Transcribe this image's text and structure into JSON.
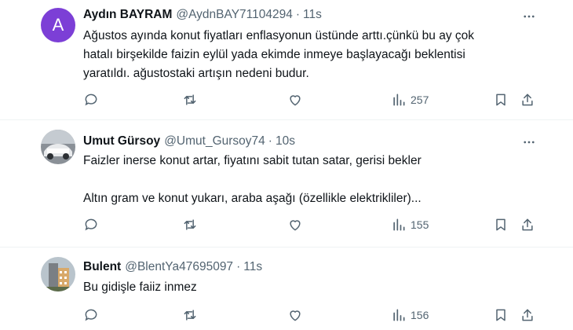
{
  "tweets": [
    {
      "avatar_letter": "A",
      "name": "Aydın BAYRAM",
      "handle": "@AydnBAY71104294",
      "separator": "·",
      "time": "11s",
      "lines": [
        "Ağustos ayında konut fiyatları enflasyonun üstünde arttı.çünkü bu ay çok",
        "hatalı birşekilde  faizin eylül yada ekimde inmeye başlayacağı beklentisi",
        "yaratıldı. ağustostaki artışın nedeni budur."
      ],
      "views": "257"
    },
    {
      "name": "Umut Gürsoy",
      "handle": "@Umut_Gursoy74",
      "separator": "·",
      "time": "10s",
      "lines": [
        "Faizler inerse konut artar, fiyatını sabit tutan satar, gerisi bekler",
        "",
        "Altın gram ve konut yukarı, araba aşağı (özellikle elektrikliler)..."
      ],
      "views": "155"
    },
    {
      "name": "Bulent",
      "handle": "@BlentYa47695097",
      "separator": "·",
      "time": "11s",
      "lines": [
        "Bu gidişle faiiz inmez"
      ],
      "views": "156"
    }
  ],
  "colors": {
    "accent_avatar": "#7c3fd6",
    "muted": "#536471",
    "text": "#0f1419"
  }
}
